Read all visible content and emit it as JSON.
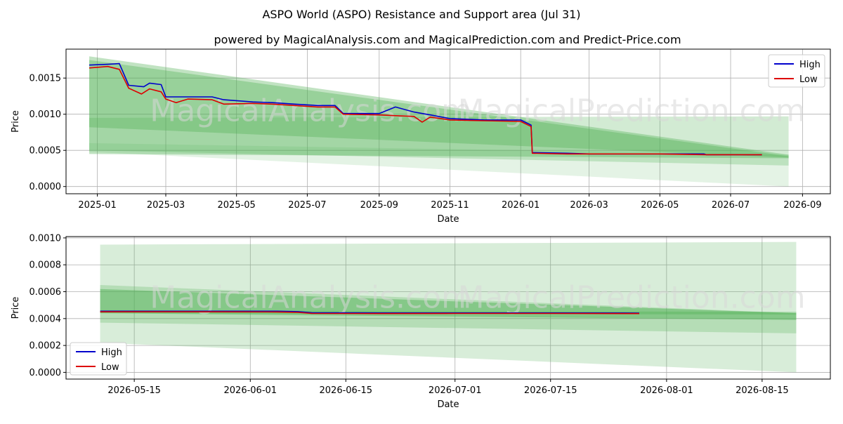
{
  "title": "ASPO World (ASPO) Resistance and Support area (Jul 31)",
  "subtitle": "powered by MagicalAnalysis.com and MagicalPrediction.com and Predict-Price.com",
  "watermarks": [
    "MagicalAnalysis.com",
    "MagicalPrediction.com"
  ],
  "colors": {
    "high": "#0000cc",
    "low": "#dd0000",
    "band": "#4caf50",
    "grid": "#b0b0b0"
  },
  "chart_data": [
    {
      "type": "line",
      "xlabel": "Date",
      "ylabel": "Price",
      "x_ticks": [
        "2025-01",
        "2025-03",
        "2025-05",
        "2025-07",
        "2025-09",
        "2025-11",
        "2026-01",
        "2026-03",
        "2026-05",
        "2026-07",
        "2026-09"
      ],
      "y_ticks": [
        "0.0000",
        "0.0005",
        "0.0010",
        "0.0015"
      ],
      "ylim": [
        -0.0001,
        0.0019
      ],
      "xlim": [
        "2024-12-05",
        "2026-09-25"
      ],
      "legend": {
        "position": "top-right",
        "entries": [
          "High",
          "Low"
        ]
      },
      "series": [
        {
          "name": "High",
          "color": "#0000cc",
          "points": [
            [
              "2024-12-25",
              0.00168
            ],
            [
              "2025-01-10",
              0.00169
            ],
            [
              "2025-01-20",
              0.0017
            ],
            [
              "2025-01-28",
              0.0014
            ],
            [
              "2025-02-10",
              0.00138
            ],
            [
              "2025-02-15",
              0.00143
            ],
            [
              "2025-02-25",
              0.00141
            ],
            [
              "2025-03-01",
              0.00124
            ],
            [
              "2025-03-20",
              0.00124
            ],
            [
              "2025-04-10",
              0.00124
            ],
            [
              "2025-04-20",
              0.0012
            ],
            [
              "2025-05-15",
              0.00117
            ],
            [
              "2025-06-01",
              0.00116
            ],
            [
              "2025-06-20",
              0.00114
            ],
            [
              "2025-07-10",
              0.00112
            ],
            [
              "2025-07-25",
              0.00112
            ],
            [
              "2025-08-01",
              0.00101
            ],
            [
              "2025-09-01",
              0.00101
            ],
            [
              "2025-09-15",
              0.0011
            ],
            [
              "2025-10-01",
              0.00103
            ],
            [
              "2025-10-15",
              0.00099
            ],
            [
              "2025-11-01",
              0.00094
            ],
            [
              "2025-12-01",
              0.00092
            ],
            [
              "2026-01-01",
              0.00092
            ],
            [
              "2026-01-10",
              0.00085
            ],
            [
              "2026-01-11",
              0.00047
            ],
            [
              "2026-02-10",
              0.00046
            ],
            [
              "2026-03-01",
              0.00045
            ],
            [
              "2026-05-01",
              0.00045
            ],
            [
              "2026-06-08",
              0.00045
            ],
            [
              "2026-06-10",
              0.00044
            ],
            [
              "2026-07-28",
              0.00044
            ]
          ]
        },
        {
          "name": "Low",
          "color": "#dd0000",
          "points": [
            [
              "2024-12-25",
              0.00164
            ],
            [
              "2025-01-10",
              0.00166
            ],
            [
              "2025-01-20",
              0.00162
            ],
            [
              "2025-01-28",
              0.00136
            ],
            [
              "2025-02-08",
              0.00128
            ],
            [
              "2025-02-15",
              0.00135
            ],
            [
              "2025-02-25",
              0.00131
            ],
            [
              "2025-03-01",
              0.00121
            ],
            [
              "2025-03-10",
              0.00116
            ],
            [
              "2025-03-20",
              0.00121
            ],
            [
              "2025-04-10",
              0.0012
            ],
            [
              "2025-04-20",
              0.00114
            ],
            [
              "2025-05-15",
              0.00115
            ],
            [
              "2025-06-01",
              0.00114
            ],
            [
              "2025-06-20",
              0.00112
            ],
            [
              "2025-07-10",
              0.0011
            ],
            [
              "2025-07-25",
              0.0011
            ],
            [
              "2025-08-01",
              0.001
            ],
            [
              "2025-09-01",
              0.00099
            ],
            [
              "2025-09-15",
              0.00098
            ],
            [
              "2025-10-01",
              0.00097
            ],
            [
              "2025-10-08",
              0.00089
            ],
            [
              "2025-10-15",
              0.00096
            ],
            [
              "2025-11-01",
              0.00092
            ],
            [
              "2025-12-01",
              0.00091
            ],
            [
              "2026-01-01",
              0.0009
            ],
            [
              "2026-01-10",
              0.00083
            ],
            [
              "2026-01-11",
              0.00046
            ],
            [
              "2026-02-10",
              0.00045
            ],
            [
              "2026-05-01",
              0.00045
            ],
            [
              "2026-06-10",
              0.00044
            ],
            [
              "2026-07-28",
              0.00044
            ]
          ]
        }
      ],
      "bands": [
        {
          "x0": "2024-12-25",
          "x1": "2026-08-20",
          "upper0": 0.0018,
          "upper1": 0.00044,
          "lower0": 0.00045,
          "lower1": 0.00039,
          "opacity": 0.35
        },
        {
          "x0": "2024-12-25",
          "x1": "2026-08-20",
          "upper0": 0.00175,
          "upper1": 0.00042,
          "lower0": 0.00082,
          "lower1": 0.0004,
          "opacity": 0.35
        },
        {
          "x0": "2024-12-25",
          "x1": "2026-08-20",
          "upper0": 0.00095,
          "upper1": 0.00097,
          "lower0": 0.0005,
          "lower1": 0.00029,
          "opacity": 0.25
        },
        {
          "x0": "2024-12-25",
          "x1": "2026-08-20",
          "upper0": 0.0006,
          "upper1": 0.00044,
          "lower0": 0.00048,
          "lower1": 0.0,
          "opacity": 0.15
        }
      ]
    },
    {
      "type": "line",
      "xlabel": "Date",
      "ylabel": "Price",
      "x_ticks": [
        "2026-05-15",
        "2026-06-01",
        "2026-06-15",
        "2026-07-01",
        "2026-07-15",
        "2026-08-01",
        "2026-08-15"
      ],
      "y_ticks": [
        "0.0000",
        "0.0002",
        "0.0004",
        "0.0006",
        "0.0008",
        "0.0010"
      ],
      "ylim": [
        -5e-05,
        0.00101
      ],
      "xlim": [
        "2026-05-05",
        "2026-08-25"
      ],
      "legend": {
        "position": "bottom-left",
        "entries": [
          "High",
          "Low"
        ]
      },
      "series": [
        {
          "name": "High",
          "color": "#0000cc",
          "points": [
            [
              "2026-05-10",
              0.000455
            ],
            [
              "2026-05-25",
              0.000455
            ],
            [
              "2026-06-05",
              0.000455
            ],
            [
              "2026-06-08",
              0.000452
            ],
            [
              "2026-06-10",
              0.000443
            ],
            [
              "2026-06-20",
              0.000442
            ],
            [
              "2026-07-01",
              0.000442
            ],
            [
              "2026-07-15",
              0.000442
            ],
            [
              "2026-07-28",
              0.000441
            ]
          ]
        },
        {
          "name": "Low",
          "color": "#dd0000",
          "points": [
            [
              "2026-05-10",
              0.00045
            ],
            [
              "2026-05-25",
              0.00045
            ],
            [
              "2026-06-05",
              0.000449
            ],
            [
              "2026-06-08",
              0.000446
            ],
            [
              "2026-06-10",
              0.000438
            ],
            [
              "2026-06-20",
              0.000437
            ],
            [
              "2026-07-01",
              0.000438
            ],
            [
              "2026-07-15",
              0.000438
            ],
            [
              "2026-07-28",
              0.000437
            ]
          ]
        }
      ],
      "bands": [
        {
          "x0": "2026-05-10",
          "x1": "2026-08-20",
          "upper0": 0.00095,
          "upper1": 0.00097,
          "lower0": 0.00022,
          "lower1": 0.0,
          "opacity": 0.22
        },
        {
          "x0": "2026-05-10",
          "x1": "2026-08-20",
          "upper0": 0.00065,
          "upper1": 0.00044,
          "lower0": 0.00037,
          "lower1": 0.00029,
          "opacity": 0.25
        },
        {
          "x0": "2026-05-10",
          "x1": "2026-08-20",
          "upper0": 0.00062,
          "upper1": 0.00044,
          "lower0": 0.00044,
          "lower1": 0.00039,
          "opacity": 0.45
        },
        {
          "x0": "2026-05-10",
          "x1": "2026-08-20",
          "upper0": 0.00046,
          "upper1": 0.00045,
          "lower0": 0.00044,
          "lower1": 0.00043,
          "opacity": 0.35
        }
      ]
    }
  ]
}
